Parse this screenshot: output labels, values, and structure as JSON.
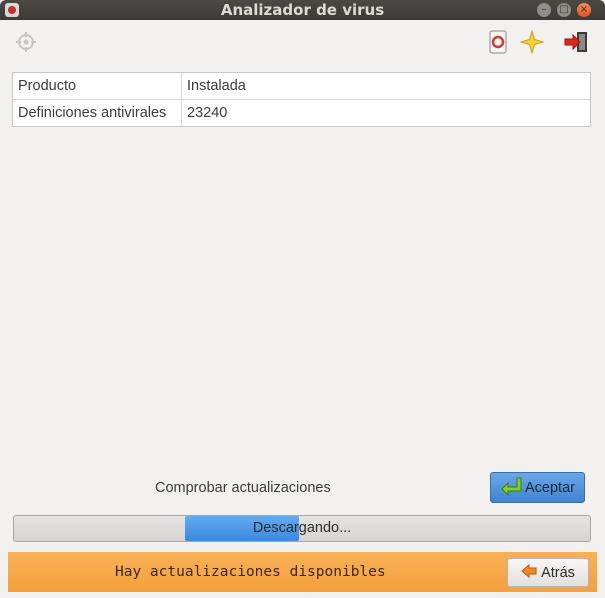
{
  "window": {
    "title": "Analizador de virus"
  },
  "toolbar": {
    "icons": [
      "target-icon",
      "lifebuoy-icon",
      "star-icon",
      "exit-icon"
    ]
  },
  "table": {
    "rows": [
      {
        "key": "Producto",
        "value": "Instalada"
      },
      {
        "key": "Definiciones antivirales",
        "value": "23240"
      }
    ]
  },
  "actions": {
    "check_updates_label": "Comprobar actualizaciones",
    "accept_label": "Aceptar"
  },
  "progress": {
    "text": "Descargando...",
    "state": "indeterminate"
  },
  "status": {
    "message": "Hay actualizaciones disponibles",
    "back_label": "Atrás"
  },
  "colors": {
    "accent_blue": "#4a90d9",
    "status_orange": "#f5a23e",
    "titlebar": "#3c3b37"
  }
}
